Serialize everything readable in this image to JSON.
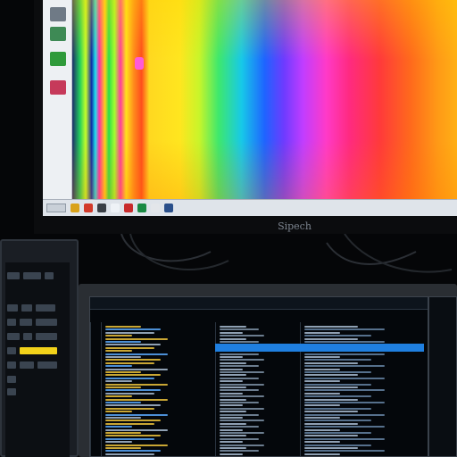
{
  "monitor_top": {
    "brand": "Sipech",
    "desktop_icons": [
      "app-icon-1",
      "app-icon-2",
      "app-icon-3",
      "app-icon-4"
    ],
    "taskbar_icons": [
      {
        "name": "folder-icon",
        "color": "#d9a21a"
      },
      {
        "name": "browser-icon",
        "color": "#d23a2a"
      },
      {
        "name": "terminal-icon",
        "color": "#3a3f45"
      },
      {
        "name": "document-icon",
        "color": "#eef2f6"
      },
      {
        "name": "record-icon",
        "color": "#c92b2b"
      },
      {
        "name": "app-icon",
        "color": "#1a8a43"
      },
      {
        "name": "file-icon",
        "color": "#e3e6ea"
      },
      {
        "name": "window-icon",
        "color": "#2a4f8a"
      }
    ],
    "accent_color": "#ff5ad8"
  },
  "monitor_bottom": {
    "header_columns": [
      "",
      "",
      "",
      ""
    ],
    "selected_row_color": "#1f7fe0"
  },
  "device_left": {
    "highlight_color": "#f2d21a"
  }
}
